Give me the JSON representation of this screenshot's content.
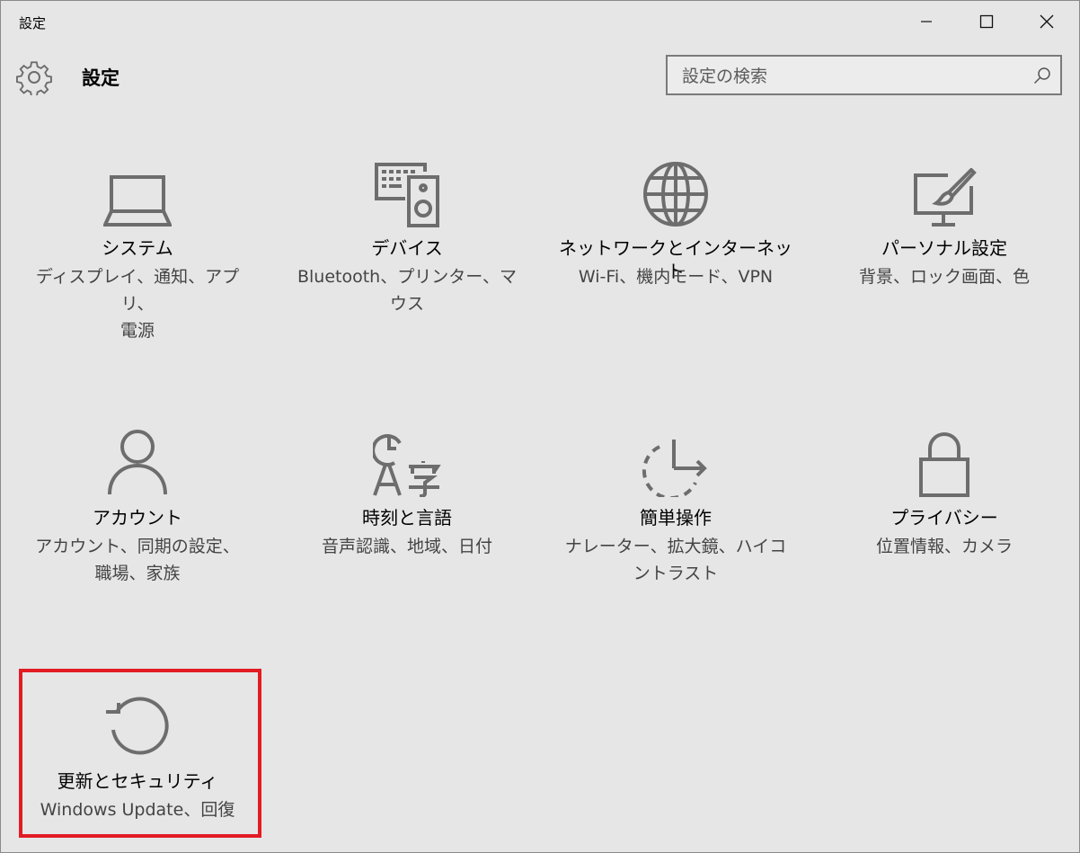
{
  "window": {
    "title": "設定",
    "controls": [
      "minimize-icon",
      "maximize-icon",
      "close-icon"
    ]
  },
  "header": {
    "title": "設定",
    "icon": "gear-icon",
    "search": {
      "placeholder": "設定の検索",
      "value": "",
      "icon": "search-icon"
    }
  },
  "tiles": [
    {
      "title": "システム",
      "desc": "ディスプレイ、通知、アプリ、\n電源",
      "icon": "laptop-icon"
    },
    {
      "title": "デバイス",
      "desc": "Bluetooth、プリンター、マ\nウス",
      "icon": "devices-icon"
    },
    {
      "title": "ネットワークとインターネット",
      "desc": "Wi-Fi、機内モード、VPN",
      "icon": "globe-icon"
    },
    {
      "title": "パーソナル設定",
      "desc": "背景、ロック画面、色",
      "icon": "personalization-icon"
    },
    {
      "title": "アカウント",
      "desc": "アカウント、同期の設定、\n職場、家族",
      "icon": "person-icon"
    },
    {
      "title": "時刻と言語",
      "desc": "音声認識、地域、日付",
      "icon": "time-language-icon"
    },
    {
      "title": "簡単操作",
      "desc": "ナレーター、拡大鏡、ハイコ\nントラスト",
      "icon": "ease-of-access-icon"
    },
    {
      "title": "プライバシー",
      "desc": "位置情報、カメラ",
      "icon": "lock-icon"
    },
    {
      "title": "更新とセキュリティ",
      "desc": "Windows Update、回復",
      "icon": "update-icon"
    }
  ],
  "colors": {
    "background": "#e6e6e6",
    "icon": "#6d6d6d",
    "highlight": "#e21c24",
    "desc_text": "#444444"
  }
}
